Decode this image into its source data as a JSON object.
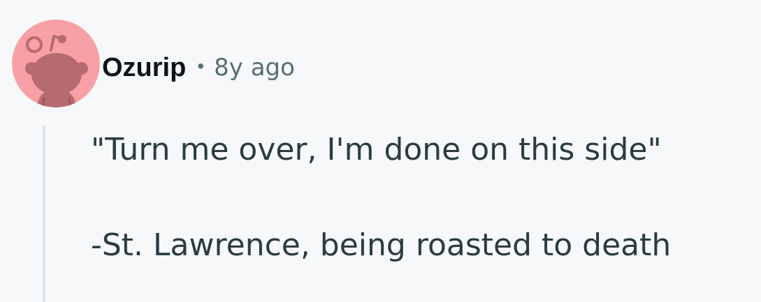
{
  "comment": {
    "author": "Ozurip",
    "separator": "•",
    "timestamp": "8y ago",
    "avatar_icon": "reddit-snoo-avatar-icon",
    "avatar_background": "#f7a0a6",
    "avatar_figure_color": "#b56b6f",
    "body": {
      "lines": [
        "\"Turn me over, I'm done on this side\"",
        "-St. Lawrence, being roasted to death"
      ]
    }
  },
  "colors": {
    "background": "#f6f8fa",
    "author": "#0b1416",
    "meta": "#576f76",
    "body": "#2a3c42",
    "thread_line": "#dfe4ea"
  }
}
